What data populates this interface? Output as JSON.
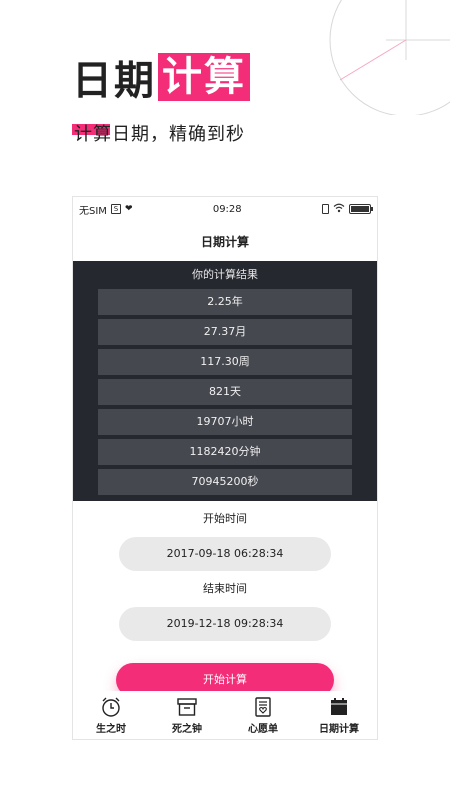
{
  "hero": {
    "title_plain": "日期",
    "title_highlight": "计算",
    "subtitle_highlight": "计算",
    "subtitle_rest": "日期，精确到秒"
  },
  "statusbar": {
    "carrier": "无SIM",
    "sim_icon_glyph": "S",
    "time": "09:28"
  },
  "navbar": {
    "title": "日期计算"
  },
  "results": {
    "title": "你的计算结果",
    "rows": [
      "2.25年",
      "27.37月",
      "117.30周",
      "821天",
      "19707小时",
      "1182420分钟",
      "70945200秒"
    ]
  },
  "form": {
    "start_label": "开始时间",
    "start_value": "2017-09-18 06:28:34",
    "end_label": "结束时间",
    "end_value": "2019-12-18 09:28:34",
    "submit_label": "开始计算"
  },
  "tabs": [
    {
      "label": "生之时",
      "icon": "alarm-clock-icon"
    },
    {
      "label": "死之钟",
      "icon": "archive-box-icon"
    },
    {
      "label": "心愿单",
      "icon": "wish-list-icon"
    },
    {
      "label": "日期计算",
      "icon": "calendar-icon"
    }
  ],
  "colors": {
    "accent": "#f42d78",
    "results_bg": "#262830",
    "result_row_bg": "#464850",
    "pill_bg": "#e9e9e9"
  }
}
